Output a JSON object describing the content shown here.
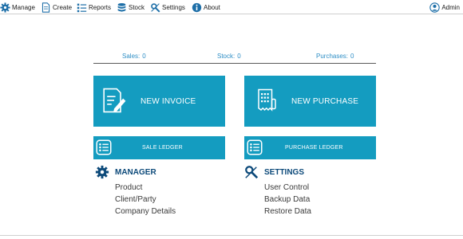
{
  "menu": {
    "manage": "Manage",
    "create": "Create",
    "reports": "Reports",
    "stock": "Stock",
    "settings": "Settings",
    "about": "About",
    "admin": "Admin"
  },
  "stats": {
    "sales_label": "Sales:",
    "sales_value": "0",
    "stock_label": "Stock:",
    "stock_value": "0",
    "purchases_label": "Purchases:",
    "purchases_value": "0"
  },
  "tiles": {
    "new_invoice": "NEW INVOICE",
    "new_purchase": "NEW PURCHASE",
    "sale_ledger": "SALE LEDGER",
    "purchase_ledger": "PURCHASE LEDGER"
  },
  "manager": {
    "title": "MANAGER",
    "links": [
      "Product",
      "Client/Party",
      "Company Details"
    ]
  },
  "settings": {
    "title": "SETTINGS",
    "links": [
      "User Control",
      "Backup Data",
      "Restore Data"
    ]
  },
  "colors": {
    "tile": "#149cc0",
    "stat_text": "#2f8fc6",
    "section_title": "#0d4a7a"
  },
  "icons": {
    "manage": "gear-icon",
    "create": "document-icon",
    "reports": "list-icon",
    "stock": "database-icon",
    "settings": "tools-icon",
    "about": "info-icon",
    "admin": "user-icon",
    "new_invoice": "invoice-pen-icon",
    "new_purchase": "receipt-icon",
    "ledger": "ledger-list-icon"
  }
}
